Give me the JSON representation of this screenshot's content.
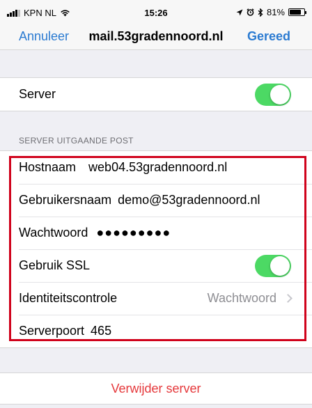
{
  "status_bar": {
    "carrier": "KPN NL",
    "time": "15:26",
    "battery": "81%",
    "battery_level": 0.81
  },
  "nav": {
    "cancel": "Annuleer",
    "title": "mail.53gradennoord.nl",
    "done": "Gereed"
  },
  "server": {
    "label": "Server",
    "enabled": true
  },
  "section_header": "SERVER UITGAANDE POST",
  "fields": {
    "hostname_label": "Hostnaam",
    "hostname_value": "web04.53gradennoord.nl",
    "username_label": "Gebruikersnaam",
    "username_value": "demo@53gradennoord.nl",
    "password_label": "Wachtwoord",
    "password_value": "●●●●●●●●●",
    "ssl_label": "Gebruik SSL",
    "ssl_enabled": true,
    "auth_label": "Identiteitscontrole",
    "auth_value": "Wachtwoord",
    "port_label": "Serverpoort",
    "port_value": "465"
  },
  "delete_button": "Verwijder server",
  "colors": {
    "accent": "#2a7ad1",
    "toggle_on": "#4cd964",
    "highlight": "#d0021b",
    "destructive": "#e5383b"
  },
  "icons": [
    "signal-icon",
    "wifi-icon",
    "location-icon",
    "alarm-icon",
    "bluetooth-icon",
    "battery-icon",
    "chevron-right-icon"
  ]
}
